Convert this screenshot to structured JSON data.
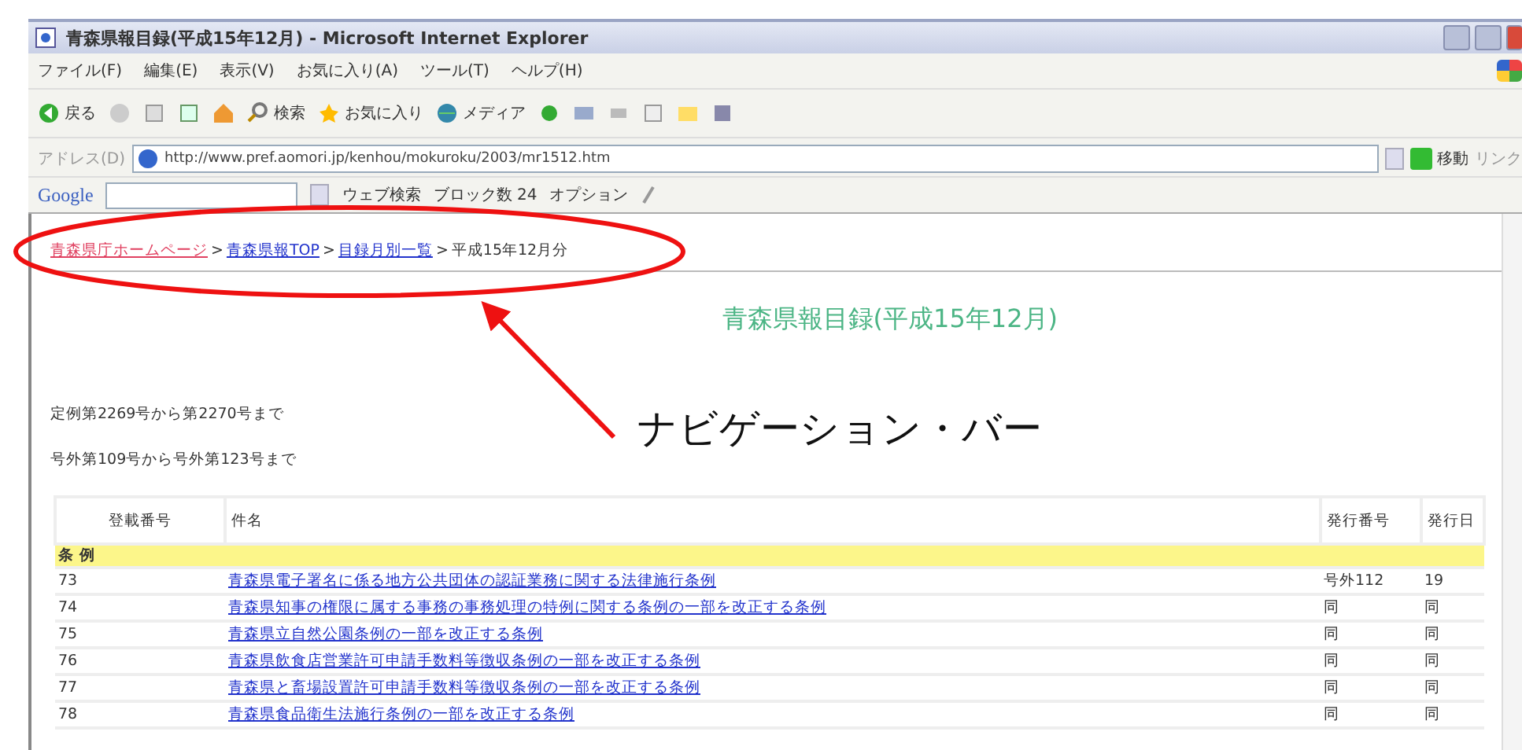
{
  "window": {
    "title": "青森県報目録(平成15年12月) - Microsoft Internet Explorer"
  },
  "menu": [
    "ファイル(F)",
    "編集(E)",
    "表示(V)",
    "お気に入り(A)",
    "ツール(T)",
    "ヘルプ(H)"
  ],
  "toolbar": {
    "back_label": "戻る",
    "search_label": "検索",
    "favorites_label": "お気に入り",
    "media_label": "メディア"
  },
  "address_bar": {
    "label": "アドレス(D)",
    "url": "http://www.pref.aomori.jp/kenhou/mokuroku/2003/mr1512.htm",
    "go_label": "移動",
    "links_label": "リンク"
  },
  "google_bar": {
    "logo": "Google",
    "search_label": "ウェブ検索",
    "blocked_label": "ブロック数 24",
    "options_label": "オプション"
  },
  "breadcrumb": [
    {
      "kind": "link",
      "text": "青森県庁ホームページ",
      "visited": true
    },
    {
      "kind": "separator",
      "text": ">"
    },
    {
      "kind": "link",
      "text": "青森県報TOP",
      "visited": false
    },
    {
      "kind": "separator",
      "text": ">"
    },
    {
      "kind": "link",
      "text": "目録月別一覧",
      "visited": false
    },
    {
      "kind": "separator",
      "text": ">"
    },
    {
      "kind": "current",
      "text": "平成15年12月分"
    }
  ],
  "heading": "青森県報目録(平成15年12月)",
  "ranges": [
    "定例第2269号から第2270号まで",
    "号外第109号から号外第123号まで"
  ],
  "table": {
    "columns": [
      "登載番号",
      "件名",
      "発行番号",
      "発行日"
    ],
    "sections": [
      {
        "title": "条 例",
        "rows": [
          {
            "number": "73",
            "title": "青森県電子署名に係る地方公共団体の認証業務に関する法律施行条例",
            "issue": "号外112",
            "date": "19"
          },
          {
            "number": "74",
            "title": "青森県知事の権限に属する事務の事務処理の特例に関する条例の一部を改正する条例",
            "issue": "同",
            "date": "同"
          },
          {
            "number": "75",
            "title": "青森県立自然公園条例の一部を改正する条例",
            "issue": "同",
            "date": "同"
          },
          {
            "number": "76",
            "title": "青森県飲食店営業許可申請手数料等徴収条例の一部を改正する条例",
            "issue": "同",
            "date": "同"
          },
          {
            "number": "77",
            "title": "青森県と畜場設置許可申請手数料等徴収条例の一部を改正する条例",
            "issue": "同",
            "date": "同"
          },
          {
            "number": "78",
            "title": "青森県食品衛生法施行条例の一部を改正する条例",
            "issue": "同",
            "date": "同"
          }
        ]
      }
    ]
  },
  "annotation": {
    "label": "ナビゲーション・バー"
  }
}
